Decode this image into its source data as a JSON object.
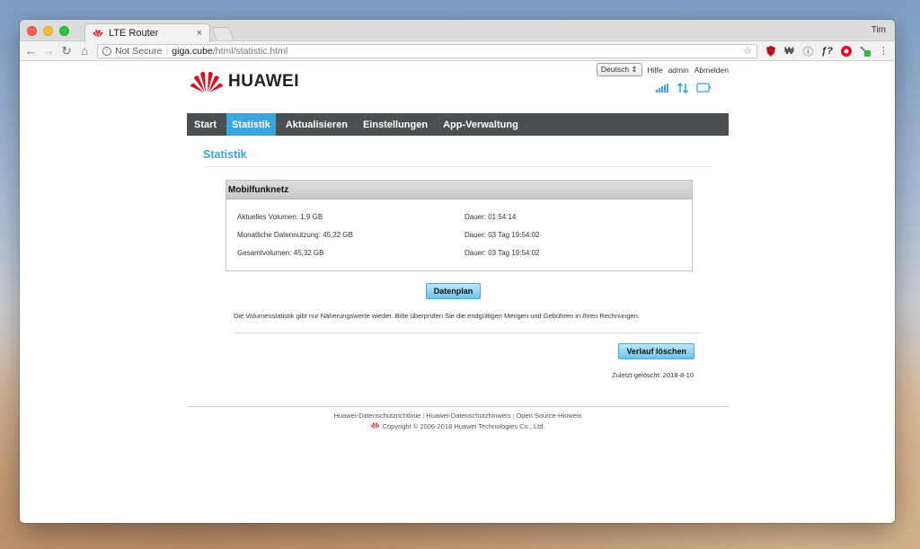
{
  "browser": {
    "tab_title": "LTE Router",
    "tab_close": "×",
    "user": "Tim",
    "not_secure": "Not Secure",
    "url_host": "giga.cube",
    "url_path": "/html/statistic.html"
  },
  "header": {
    "brand": "HUAWEI",
    "language": "Deutsch",
    "help": "Hilfe",
    "admin": "admin",
    "logout": "Abmelden"
  },
  "nav": {
    "items": [
      {
        "label": "Start"
      },
      {
        "label": "Statistik"
      },
      {
        "label": "Aktualisieren"
      },
      {
        "label": "Einstellungen"
      },
      {
        "label": "App-Verwaltung"
      }
    ],
    "active_index": 1
  },
  "main": {
    "title": "Statistik",
    "panel_title": "Mobilfunknetz",
    "stats": [
      {
        "label": "Aktuelles Volumen: 1,9 GB",
        "duration": "Dauer: 01:54:14"
      },
      {
        "label": "Monatliche Datennutzung: 45,32 GB",
        "duration": "Dauer: 03 Tag 19:54:02"
      },
      {
        "label": "Gesamtvolumen: 45,32 GB",
        "duration": "Dauer: 03 Tag 19:54:02"
      }
    ],
    "datenplan_button": "Datenplan",
    "note": "Die Volumenstatistik gibt nur Näherungswerte wieder. Bitte überprüfen Sie die endgültigen Mengen und Gebühren in Ihren Rechnungen.",
    "clear_button": "Verlauf löschen",
    "last_cleared": "Zuletzt gelöscht: 2018-8-10"
  },
  "footer": {
    "privacy_policy": "Huawei-Datenschutzrichtlinie",
    "privacy_notice": "Huawei-Datenschutzhinweis",
    "open_source": "Open Source-Hinweis",
    "copyright": "Copyright © 2006-2018 Huawei Technologies Co., Ltd."
  },
  "colors": {
    "accent": "#3aa7dc",
    "nav_bg": "#4a4f52",
    "huawei_red": "#d7131d"
  }
}
